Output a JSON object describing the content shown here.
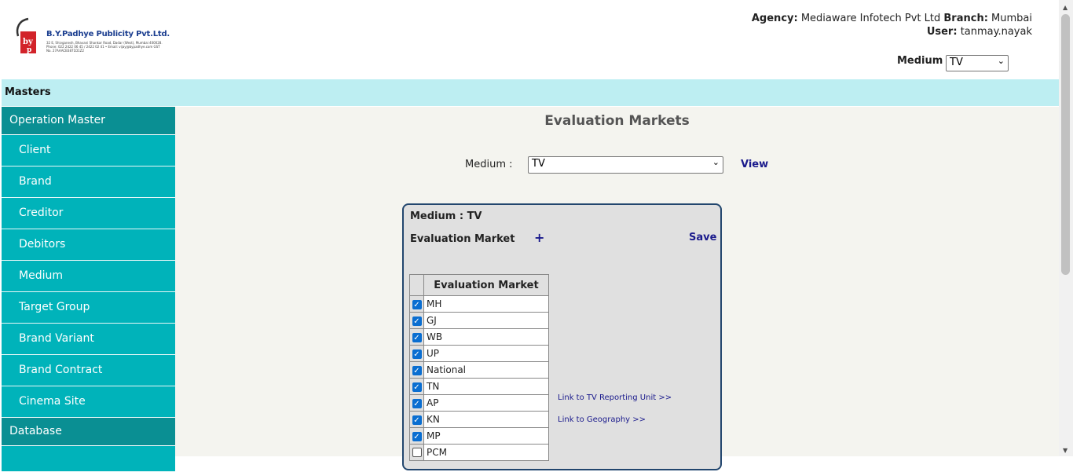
{
  "header": {
    "logo_title": "B.Y.Padhye Publicity Pvt.Ltd.",
    "logo_subtext": "32 E, Shivganesh, Bhavani Shankar Road, Dadar (West), Mumbai 400028. Phone: 022 2422 06 45 / 2422 02 41 • Email: vijay@bypadhye.com GST No. 27AAACB3871D1Z2",
    "agency_label": "Agency:",
    "agency_value": "Mediaware Infotech Pvt Ltd",
    "branch_label": "Branch:",
    "branch_value": "Mumbai",
    "user_label": "User:",
    "user_value": "tanmay.nayak",
    "medium_label": "Medium",
    "medium_value": "TV"
  },
  "masters_bar": {
    "label": "Masters"
  },
  "sidebar": {
    "sections": [
      {
        "title": "Operation Master",
        "items": [
          "Client",
          "Brand",
          "Creditor",
          "Debitors",
          "Medium",
          "Target Group",
          "Brand Variant",
          "Brand Contract",
          "Cinema Site"
        ]
      },
      {
        "title": "Database",
        "items": []
      }
    ]
  },
  "main": {
    "title": "Evaluation Markets",
    "medium_label": "Medium :",
    "medium_value": "TV",
    "view_label": "View",
    "panel": {
      "medium_line": "Medium : TV",
      "section_label": "Evaluation Market",
      "add_icon": "+",
      "save_label": "Save",
      "table_header": "Evaluation Market",
      "rows": [
        {
          "name": "MH",
          "checked": true
        },
        {
          "name": "GJ",
          "checked": true
        },
        {
          "name": "WB",
          "checked": true
        },
        {
          "name": "UP",
          "checked": true
        },
        {
          "name": "National",
          "checked": true
        },
        {
          "name": "TN",
          "checked": true
        },
        {
          "name": "AP",
          "checked": true
        },
        {
          "name": "KN",
          "checked": true
        },
        {
          "name": "MP",
          "checked": true
        },
        {
          "name": "PCM",
          "checked": false
        }
      ],
      "link_reporting": "Link to TV Reporting Unit >>",
      "link_geography": "Link to Geography >>"
    }
  },
  "colors": {
    "sidebar_head": "#0a8f93",
    "sidebar_item": "#00b3ba",
    "masters_bar": "#bdeef2",
    "link": "#1a1a8c",
    "panel_border": "#22466e"
  }
}
